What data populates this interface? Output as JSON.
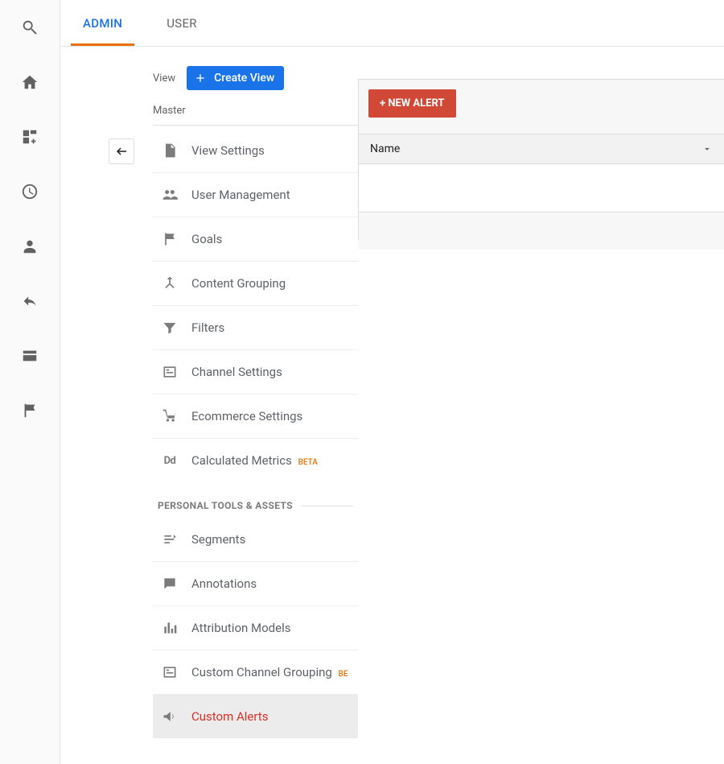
{
  "tabs": {
    "admin": "ADMIN",
    "user": "USER"
  },
  "view": {
    "label": "View",
    "create_button": "Create View",
    "selected_name": "Master"
  },
  "menu": {
    "items": [
      {
        "label": "View Settings"
      },
      {
        "label": "User Management"
      },
      {
        "label": "Goals"
      },
      {
        "label": "Content Grouping"
      },
      {
        "label": "Filters"
      },
      {
        "label": "Channel Settings"
      },
      {
        "label": "Ecommerce Settings"
      },
      {
        "label": "Calculated Metrics",
        "badge": "BETA"
      }
    ],
    "section_title": "PERSONAL TOOLS & ASSETS",
    "personal": [
      {
        "label": "Segments"
      },
      {
        "label": "Annotations"
      },
      {
        "label": "Attribution Models"
      },
      {
        "label": "Custom Channel Grouping",
        "badge": "BE"
      },
      {
        "label": "Custom Alerts",
        "selected": true
      }
    ]
  },
  "alert_panel": {
    "new_button": "+ NEW ALERT",
    "table": {
      "col_name": "Name"
    }
  }
}
